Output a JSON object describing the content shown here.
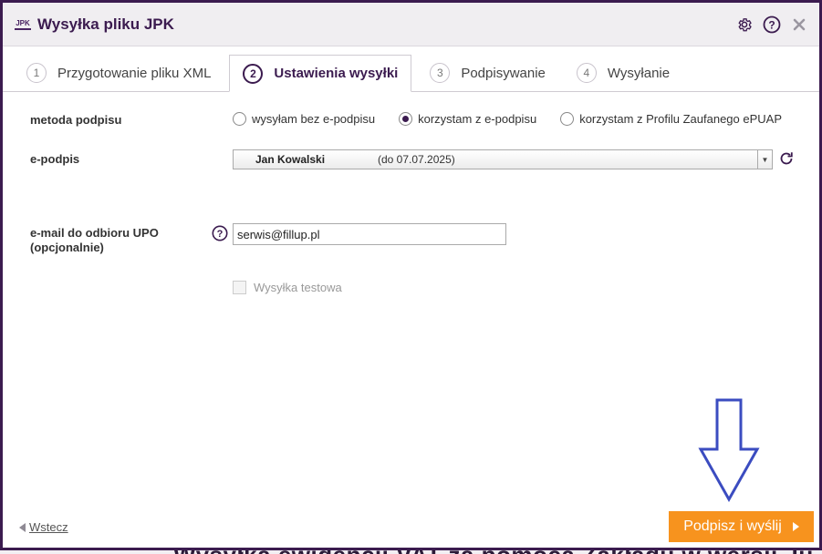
{
  "window": {
    "logo_text": "JPK",
    "title": "Wysyłka pliku JPK"
  },
  "tabs": [
    {
      "num": "1",
      "label": "Przygotowanie pliku XML"
    },
    {
      "num": "2",
      "label": "Ustawienia wysyłki"
    },
    {
      "num": "3",
      "label": "Podpisywanie"
    },
    {
      "num": "4",
      "label": "Wysyłanie"
    }
  ],
  "form": {
    "signature_method_label": "metoda podpisu",
    "radio_options": [
      {
        "label": "wysyłam bez e-podpisu",
        "selected": false
      },
      {
        "label": "korzystam z e-podpisu",
        "selected": true
      },
      {
        "label": "korzystam z Profilu Zaufanego ePUAP",
        "selected": false
      }
    ],
    "esignature_label": "e-podpis",
    "esignature_name": "Jan Kowalski",
    "esignature_validity": "(do 07.07.2025)",
    "email_label_line1": "e-mail do odbioru UPO",
    "email_label_line2": "(opcjonalnie)",
    "email_value": "serwis@fillup.pl",
    "test_send_label": "Wysyłka testowa"
  },
  "footer": {
    "back_label": "Wstecz",
    "submit_label": "Podpisz i wyślij"
  },
  "background_text": "Wysyłka ewidencji VAT za pomocą Zakładu w wersji Ju",
  "colors": {
    "brand": "#3b1b4f",
    "accent": "#f7931e",
    "annotation_arrow": "#3b4cc0"
  }
}
